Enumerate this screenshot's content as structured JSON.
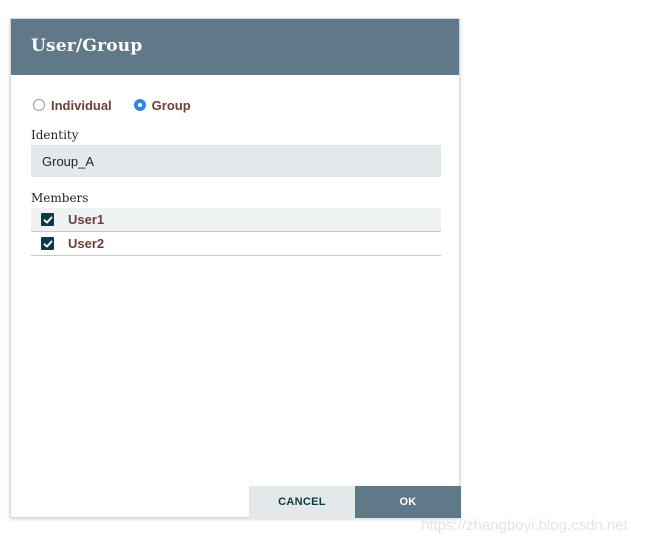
{
  "dialog": {
    "title": "User/Group",
    "radio_options": [
      {
        "label": "Individual",
        "selected": false
      },
      {
        "label": "Group",
        "selected": true
      }
    ],
    "identity": {
      "label": "Identity",
      "value": "Group_A"
    },
    "members": {
      "label": "Members",
      "items": [
        {
          "label": "User1",
          "checked": true
        },
        {
          "label": "User2",
          "checked": true
        }
      ]
    },
    "buttons": {
      "cancel": "CANCEL",
      "ok": "OK"
    }
  },
  "watermark": "https://zhangboyi.blog.csdn.net",
  "colors": {
    "header": "#5f7988",
    "radio_selected": "#2f83f0",
    "checkbox": "#0f3a45",
    "label_text": "#6b3f3a",
    "input_bg": "#e3e8eb"
  },
  "icons": {
    "checkbox": "check-icon",
    "radio": "radio-icon"
  }
}
